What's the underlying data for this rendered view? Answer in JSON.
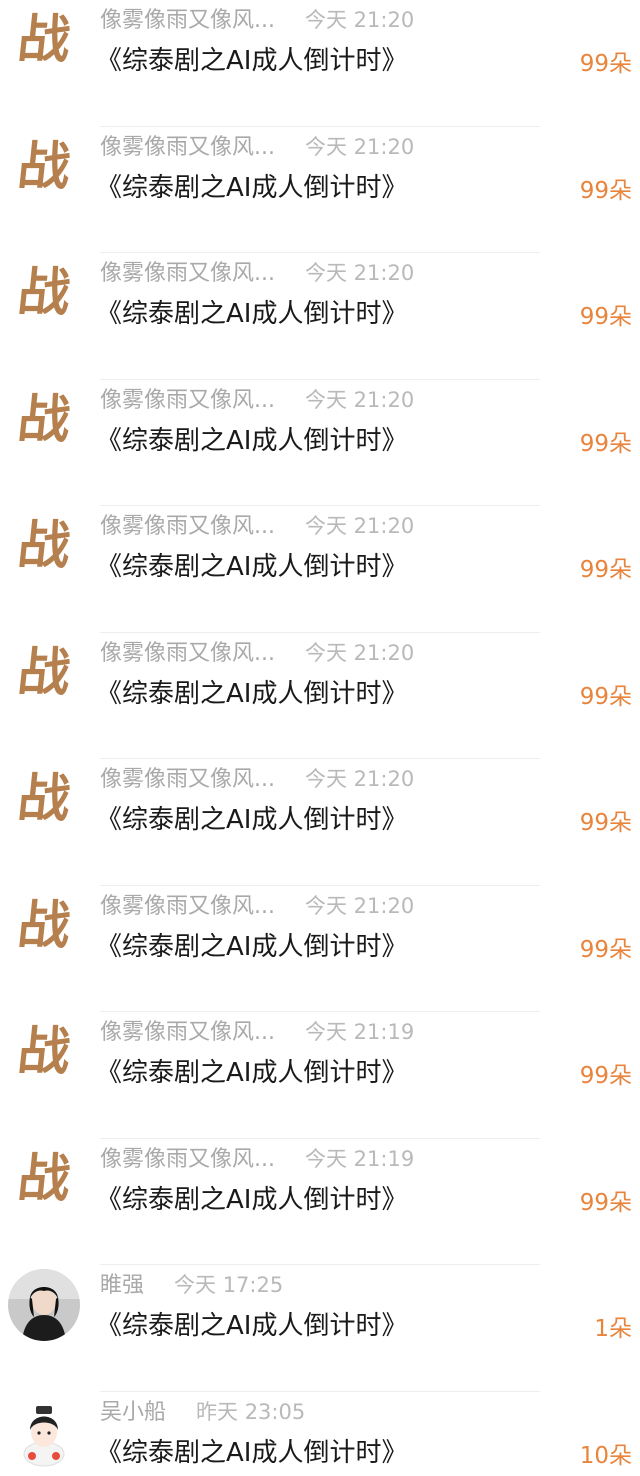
{
  "rows": [
    {
      "avatar": "logo",
      "logo_text": "战",
      "name": "像雾像雨又像风...",
      "time": "今天 21:20",
      "title": "《综泰剧之AI成人倒计时》",
      "count": "99朵"
    },
    {
      "avatar": "logo",
      "logo_text": "战",
      "name": "像雾像雨又像风...",
      "time": "今天 21:20",
      "title": "《综泰剧之AI成人倒计时》",
      "count": "99朵"
    },
    {
      "avatar": "logo",
      "logo_text": "战",
      "name": "像雾像雨又像风...",
      "time": "今天 21:20",
      "title": "《综泰剧之AI成人倒计时》",
      "count": "99朵"
    },
    {
      "avatar": "logo",
      "logo_text": "战",
      "name": "像雾像雨又像风...",
      "time": "今天 21:20",
      "title": "《综泰剧之AI成人倒计时》",
      "count": "99朵"
    },
    {
      "avatar": "logo",
      "logo_text": "战",
      "name": "像雾像雨又像风...",
      "time": "今天 21:20",
      "title": "《综泰剧之AI成人倒计时》",
      "count": "99朵"
    },
    {
      "avatar": "logo",
      "logo_text": "战",
      "name": "像雾像雨又像风...",
      "time": "今天 21:20",
      "title": "《综泰剧之AI成人倒计时》",
      "count": "99朵"
    },
    {
      "avatar": "logo",
      "logo_text": "战",
      "name": "像雾像雨又像风...",
      "time": "今天 21:20",
      "title": "《综泰剧之AI成人倒计时》",
      "count": "99朵"
    },
    {
      "avatar": "logo",
      "logo_text": "战",
      "name": "像雾像雨又像风...",
      "time": "今天 21:20",
      "title": "《综泰剧之AI成人倒计时》",
      "count": "99朵"
    },
    {
      "avatar": "logo",
      "logo_text": "战",
      "name": "像雾像雨又像风...",
      "time": "今天 21:19",
      "title": "《综泰剧之AI成人倒计时》",
      "count": "99朵"
    },
    {
      "avatar": "logo",
      "logo_text": "战",
      "name": "像雾像雨又像风...",
      "time": "今天 21:19",
      "title": "《综泰剧之AI成人倒计时》",
      "count": "99朵"
    },
    {
      "avatar": "photo-dark",
      "name": "睢强",
      "time": "今天 17:25",
      "title": "《综泰剧之AI成人倒计时》",
      "count": "1朵"
    },
    {
      "avatar": "photo-cartoon",
      "name": "吴小船",
      "time": "昨天 23:05",
      "title": "《综泰剧之AI成人倒计时》",
      "count": "10朵"
    }
  ],
  "colors": {
    "accent": "#e8843c",
    "logo": "#b5804d",
    "meta": "#a9a9a9",
    "title": "#1a1a1a"
  }
}
